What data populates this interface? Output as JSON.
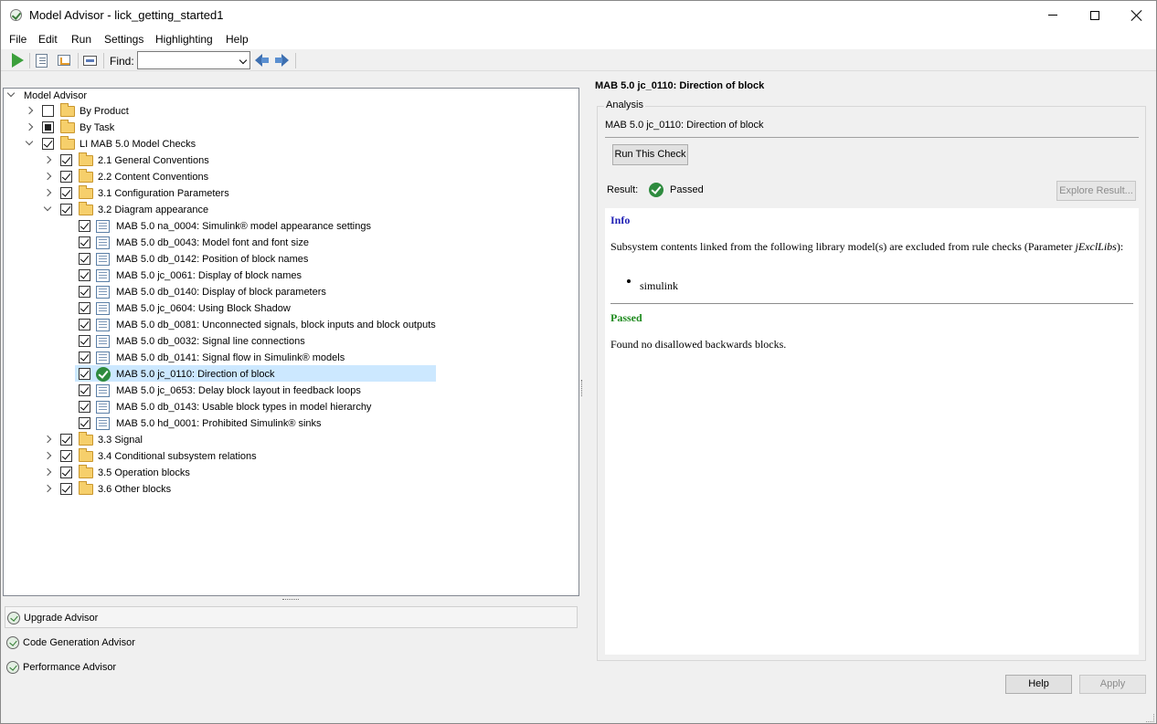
{
  "window": {
    "title": "Model Advisor - lick_getting_started1"
  },
  "menubar": {
    "items": [
      "File",
      "Edit",
      "Run",
      "Settings",
      "Highlighting",
      "Help"
    ]
  },
  "toolbar": {
    "find_label": "Find:",
    "find_value": ""
  },
  "tree": {
    "root": "Model Advisor",
    "by_product": "By Product",
    "by_task": "By Task",
    "li_checks": "LI MAB 5.0 Model Checks",
    "sections": [
      "2.1 General Conventions",
      "2.2 Content Conventions",
      "3.1 Configuration Parameters",
      "3.2 Diagram appearance",
      "3.3 Signal",
      "3.4 Conditional subsystem relations",
      "3.5 Operation blocks",
      "3.6 Other blocks"
    ],
    "checks": [
      "MAB 5.0 na_0004: Simulink® model appearance settings",
      "MAB 5.0 db_0043: Model font and font size",
      "MAB 5.0 db_0142: Position of block names",
      "MAB 5.0 jc_0061: Display of block names",
      "MAB 5.0 db_0140: Display of block parameters",
      "MAB 5.0 jc_0604: Using Block Shadow",
      "MAB 5.0 db_0081: Unconnected signals, block inputs and block outputs",
      "MAB 5.0 db_0032: Signal line connections",
      "MAB 5.0 db_0141: Signal flow in Simulink® models",
      "MAB 5.0 jc_0110: Direction of block",
      "MAB 5.0 jc_0653: Delay block layout in feedback loops",
      "MAB 5.0 db_0143: Usable block types in model hierarchy",
      "MAB 5.0 hd_0001: Prohibited Simulink® sinks"
    ],
    "selected_check": "MAB 5.0 jc_0110: Direction of block"
  },
  "advisors": [
    "Upgrade Advisor",
    "Code Generation Advisor",
    "Performance Advisor"
  ],
  "detail": {
    "title": "MAB 5.0 jc_0110: Direction of block",
    "analysis_legend": "Analysis",
    "analysis_subtitle": "MAB 5.0 jc_0110: Direction of block",
    "run_button": "Run This Check",
    "result_label": "Result:",
    "result_value": "Passed",
    "explore_button": "Explore Result...",
    "report": {
      "info_heading": "Info",
      "info_text_1": "Subsystem contents linked from the following library model(s) are excluded from rule checks (Parameter ",
      "info_param": "jExclLibs",
      "info_text_2": "):",
      "library": "simulink",
      "passed_heading": "Passed",
      "passed_text": "Found no disallowed backwards blocks."
    },
    "help_button": "Help",
    "apply_button": "Apply"
  },
  "colors": {
    "selection": "#cce8ff",
    "pass_green": "#2e8b3e",
    "info_blue": "#1f1fb4"
  }
}
